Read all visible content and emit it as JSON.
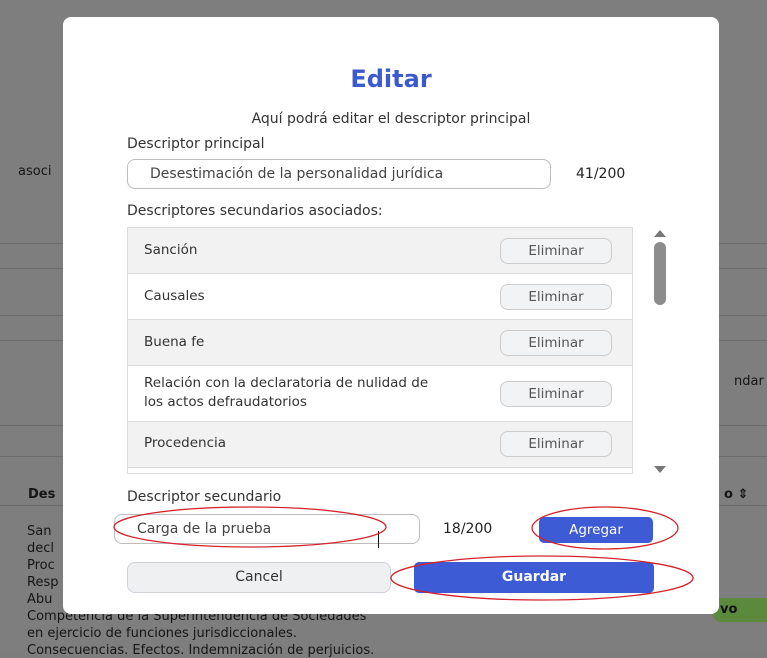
{
  "background": {
    "fragment_asoci": "asoci",
    "fragment_ndar": "ndar",
    "fragment_des": "Des",
    "fragment_sort": "o ⇕",
    "list_fragments": [
      "San",
      "decl",
      "Proc",
      "Resp",
      "Abu"
    ],
    "bottom_lines": [
      "Competencia de la Superintendencia de Sociedades",
      "en ejercicio de funciones jurisdiccionales.",
      "Consecuencias. Efectos. Indemnización de perjuicios."
    ],
    "badge_fragment": "vo"
  },
  "modal": {
    "title": "Editar",
    "subtitle": "Aquí podrá editar el descriptor principal",
    "primary": {
      "label": "Descriptor principal",
      "value": "Desestimación de la personalidad jurídica",
      "counter": "41/200"
    },
    "secondary_list": {
      "label": "Descriptores secundarios asociados:",
      "items": [
        {
          "text": "Sanción",
          "button": "Eliminar"
        },
        {
          "text": "Causales",
          "button": "Eliminar"
        },
        {
          "text": "Buena fe",
          "button": "Eliminar"
        },
        {
          "text": "Relación con la declaratoria de nulidad de los actos defraudatorios",
          "button": "Eliminar"
        },
        {
          "text": "Procedencia",
          "button": "Eliminar"
        }
      ]
    },
    "secondary_input": {
      "label": "Descriptor secundario",
      "value": "Carga de la prueba",
      "counter": "18/200",
      "add_button": "Agregar"
    },
    "cancel_button": "Cancel",
    "save_button": "Guardar"
  },
  "colors": {
    "accent": "#3d5bd4",
    "annotation": "#d4232b",
    "overlay": "#7e7e7e"
  }
}
